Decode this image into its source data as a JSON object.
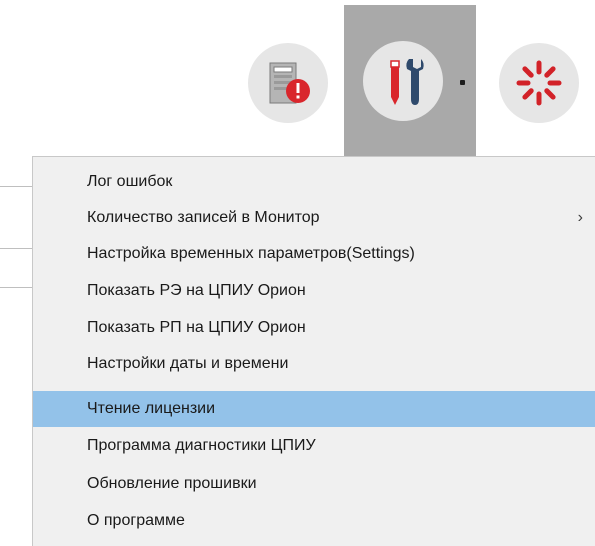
{
  "toolbar": {
    "tools": [
      {
        "name": "error-log-tool",
        "icon": "error-server-icon"
      },
      {
        "name": "settings-tool",
        "icon": "tools-icon",
        "active": true,
        "has_dropdown": true
      },
      {
        "name": "status-tool",
        "icon": "loading-spinner-icon"
      }
    ]
  },
  "menu": {
    "items": [
      {
        "label": "Лог ошибок"
      },
      {
        "label": "Количество записей в Монитор",
        "has_submenu": true,
        "submenu_glyph": "›"
      },
      {
        "label": "Настройка временных параметров(Settings)"
      },
      {
        "label": "Показать РЭ на ЦПИУ Орион"
      },
      {
        "label": "Показать РП на ЦПИУ Орион"
      },
      {
        "label": "Настройки даты и времени"
      },
      {
        "label": "Чтение лицензии",
        "highlighted": true
      },
      {
        "label": "Программа диагностики ЦПИУ"
      },
      {
        "label": "Обновление прошивки"
      },
      {
        "label": "О программе"
      }
    ]
  },
  "colors": {
    "highlight": "#93c2e9",
    "active_tool_bg": "#a9a9a9",
    "error_red": "#d9262c",
    "wrench_blue": "#2f4a6c",
    "spinner_red": "#d22228"
  }
}
